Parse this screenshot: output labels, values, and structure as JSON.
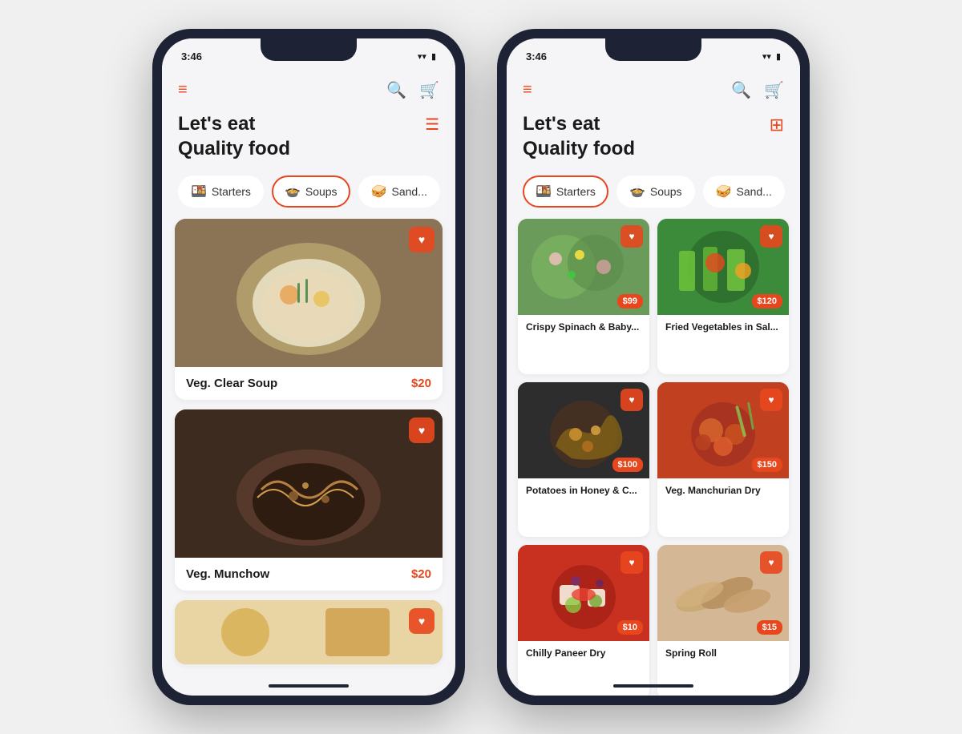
{
  "phones": [
    {
      "id": "phone-list",
      "time": "3:46",
      "wifi": "wifi",
      "battery": "battery",
      "title_line1": "Let's eat",
      "title_line2": "Quality food",
      "view_icon": "≡",
      "categories": [
        {
          "id": "starters",
          "label": "Starters",
          "emoji": "🍱",
          "active": false
        },
        {
          "id": "soups",
          "label": "Soups",
          "emoji": "🍲",
          "active": true
        },
        {
          "id": "sandwiches",
          "label": "Sand...",
          "emoji": "🥪",
          "active": false
        }
      ],
      "foods": [
        {
          "id": "veg-clear-soup",
          "name": "Veg. Clear Soup",
          "price": "$20",
          "imgClass": "img-soup1",
          "emoji": "🍲"
        },
        {
          "id": "veg-munchow",
          "name": "Veg. Munchow",
          "price": "$20",
          "imgClass": "img-soup2",
          "emoji": "🍜"
        },
        {
          "id": "more-soup",
          "name": "",
          "price": "",
          "imgClass": "img-soup3",
          "emoji": "🍛",
          "partial": true
        }
      ]
    },
    {
      "id": "phone-grid",
      "time": "3:46",
      "wifi": "wifi",
      "battery": "battery",
      "title_line1": "Let's eat",
      "title_line2": "Quality food",
      "view_icon": "⊞",
      "categories": [
        {
          "id": "starters",
          "label": "Starters",
          "emoji": "🍱",
          "active": true
        },
        {
          "id": "soups",
          "label": "Soups",
          "emoji": "🍲",
          "active": false
        },
        {
          "id": "sandwiches",
          "label": "Sand...",
          "emoji": "🥪",
          "active": false
        }
      ],
      "grid_foods": [
        {
          "id": "crispy-spinach",
          "name": "Crispy Spinach & Baby...",
          "price": "$99",
          "imgClass": "img-spinach",
          "emoji": "🥗"
        },
        {
          "id": "fried-vegetables",
          "name": "Fried Vegetables in Sal...",
          "price": "$120",
          "imgClass": "img-fried-veg",
          "emoji": "🥦"
        },
        {
          "id": "potatoes-honey",
          "name": "Potatoes in Honey & C...",
          "price": "$100",
          "imgClass": "img-potatoes",
          "emoji": "🍢"
        },
        {
          "id": "veg-manchurian",
          "name": "Veg. Manchurian Dry",
          "price": "$150",
          "imgClass": "img-manchurian",
          "emoji": "🍖"
        },
        {
          "id": "chilly-paneer",
          "name": "Chilly Paneer Dry",
          "price": "$10",
          "imgClass": "img-chilly",
          "emoji": "🌶"
        },
        {
          "id": "spring-roll",
          "name": "Spring Roll",
          "price": "$15",
          "imgClass": "img-springroll",
          "emoji": "🥢"
        }
      ]
    }
  ],
  "icons": {
    "menu": "≡",
    "search": "🔍",
    "cart": "🛒",
    "heart": "♥",
    "wifi": "▾▾",
    "battery": "▮"
  }
}
